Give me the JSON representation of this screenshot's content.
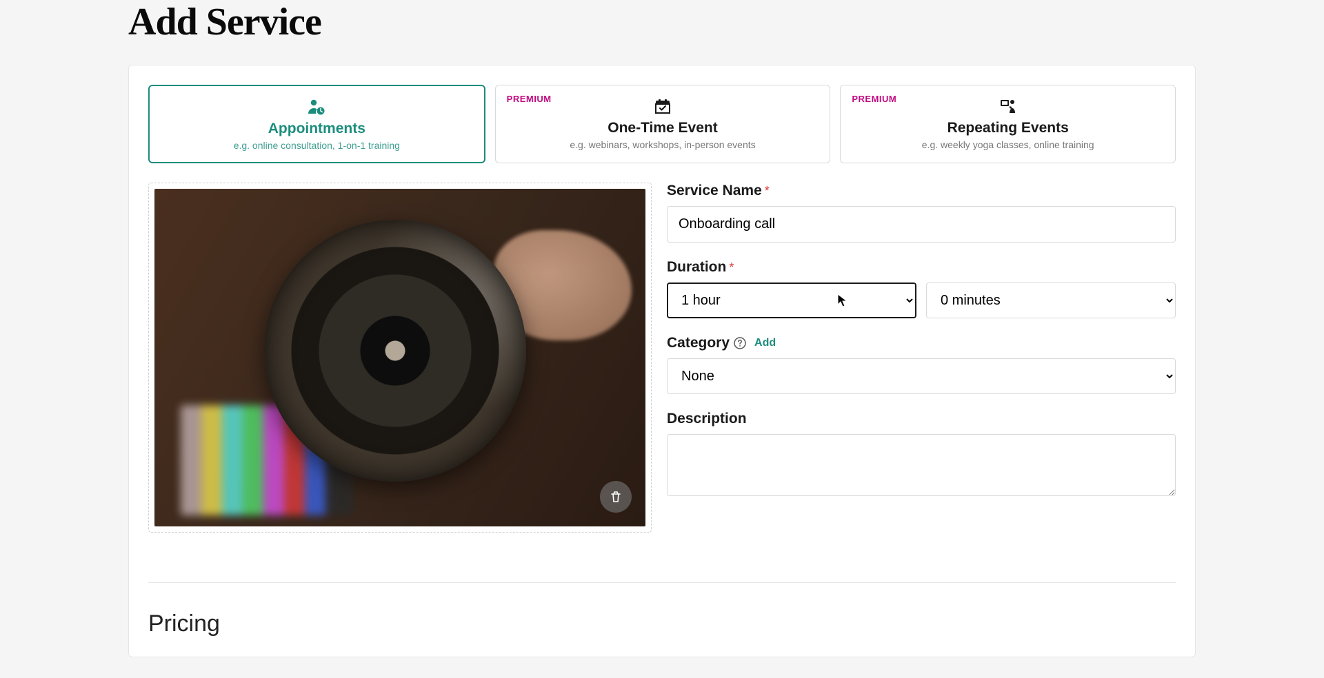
{
  "page_title": "Add Service",
  "types": {
    "premium_label": "PREMIUM",
    "appointments": {
      "title": "Appointments",
      "sub": "e.g. online consultation, 1-on-1 training"
    },
    "one_time": {
      "title": "One-Time Event",
      "sub": "e.g. webinars, workshops, in-person events"
    },
    "repeating": {
      "title": "Repeating Events",
      "sub": "e.g. weekly yoga classes, online training"
    }
  },
  "form": {
    "service_name_label": "Service Name",
    "service_name_value": "Onboarding call",
    "duration_label": "Duration",
    "duration_hours_value": "1 hour",
    "duration_minutes_value": "0 minutes",
    "category_label": "Category",
    "category_add": "Add",
    "category_value": "None",
    "description_label": "Description",
    "description_value": ""
  },
  "pricing_heading": "Pricing"
}
